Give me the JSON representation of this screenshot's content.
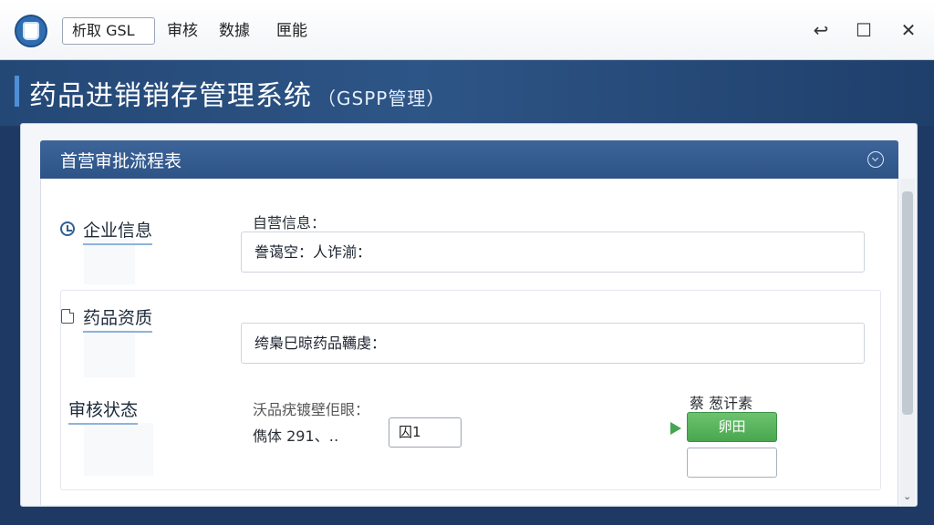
{
  "toolbar": {
    "active_menu": "析取 GSL",
    "menu_items": [
      "审核",
      "数據",
      "匣能"
    ]
  },
  "window_controls": {
    "restore": "↩",
    "maximize": "☐",
    "close": "✕"
  },
  "header": {
    "title": "药品进销销存管理系统",
    "subtitle": "（GSPP管理）"
  },
  "section": {
    "title": "首营审批流程表"
  },
  "enterprise": {
    "label": "企业信息",
    "field_label": "自营信息：",
    "field_value": "誊蔼空：人诈湔："
  },
  "drug": {
    "label": "药品资质",
    "field_value": "绔梟巳晾药品韉虔："
  },
  "review": {
    "label": "审核状态",
    "field_label": "沃品疣镀壁佢眼：",
    "line_text": "儁体 291、‥",
    "input_value": "囚1",
    "status_caption": "蔡  葱讦素",
    "green_button": "卵田"
  },
  "icons": {
    "app": "app-logo-icon",
    "enterprise": "clock-icon",
    "drug": "document-icon",
    "collapse": "collapse-circle-icon",
    "arrow": "green-arrow-icon"
  },
  "colors": {
    "header_blue": "#2d5586",
    "section_blue": "#3d659a",
    "accent_green": "#4aa650"
  }
}
